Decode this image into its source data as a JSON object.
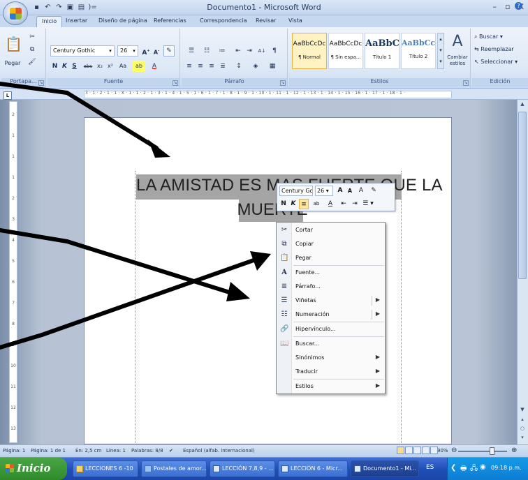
{
  "window": {
    "title": "Documento1 - Microsoft Word",
    "controls": [
      "–",
      "▫",
      "X"
    ]
  },
  "quick_access": {
    "icons": [
      "save-icon",
      "undo-icon",
      "redo-icon",
      "print-preview-icon",
      "print-icon",
      "customize-icon"
    ]
  },
  "ribbon": {
    "tabs": [
      "Inicio",
      "Insertar",
      "Diseño de página",
      "Referencias",
      "Correspondencia",
      "Revisar",
      "Vista"
    ],
    "clipboard": {
      "paste_label": "Pegar",
      "group_label": "Portapa..."
    },
    "font": {
      "font_name": "Century Gothic",
      "font_size": "26",
      "group_label": "Fuente"
    },
    "paragraph": {
      "group_label": "Párrafo"
    },
    "styles": {
      "items": [
        {
          "preview": "AaBbCcDc",
          "name": "¶ Normal"
        },
        {
          "preview": "AaBbCcDc",
          "name": "¶ Sin espa..."
        },
        {
          "preview": "AaBbC",
          "name": "Título 1"
        },
        {
          "preview": "AaBbCc",
          "name": "Título 2"
        }
      ],
      "change_styles": "Cambiar estilos",
      "group_label": "Estilos"
    },
    "editing": {
      "find": "Buscar",
      "replace": "Reemplazar",
      "select": "Seleccionar",
      "group_label": "Edición"
    }
  },
  "ruler": {
    "ticks": "3 · 1 · 2 · 1 · 1 · X · 1 · 1 · 2 · 1 · 3 · 1 · 4 · 1 · 5 · 1 · 6 · 1 · 7 · 1 · 8 · 1 · 9 · 1 · 10 · 1 · 11 · 1 · 12 · 1 · 13 · 1 · 14 · 1 · 15 · 16 · 1 · 17 · 1 · 18 · 1 ·",
    "vertical_ticks": [
      "2",
      "1",
      "1",
      "1",
      "2",
      "3",
      "4",
      "5",
      "6",
      "7",
      "8",
      "9",
      "10",
      "11",
      "12",
      "13"
    ]
  },
  "document": {
    "line1": "LA AMISTAD ES MAS FUERTE QUE LA",
    "line2": "MUERTE"
  },
  "mini_toolbar": {
    "font": "Century Go",
    "size": "26",
    "bold": "N",
    "italic": "K"
  },
  "context_menu": {
    "items": [
      {
        "label": "Cortar",
        "icon": "scissors-icon",
        "submenu": false
      },
      {
        "label": "Copiar",
        "icon": "copy-icon",
        "submenu": false
      },
      {
        "label": "Pegar",
        "icon": "paste-icon",
        "submenu": false
      },
      {
        "label": "Fuente...",
        "icon": "font-icon",
        "submenu": false
      },
      {
        "label": "Párrafo...",
        "icon": "paragraph-icon",
        "submenu": false
      },
      {
        "label": "Viñetas",
        "icon": "bullets-icon",
        "submenu": true
      },
      {
        "label": "Numeración",
        "icon": "numbering-icon",
        "submenu": true
      },
      {
        "label": "Hipervínculo...",
        "icon": "hyperlink-icon",
        "submenu": false
      },
      {
        "label": "Buscar...",
        "icon": "research-icon",
        "submenu": false
      },
      {
        "label": "Sinónimos",
        "icon": "",
        "submenu": true
      },
      {
        "label": "Traducir",
        "icon": "",
        "submenu": true
      },
      {
        "label": "Estilos",
        "icon": "",
        "submenu": true
      }
    ]
  },
  "status": {
    "page": "Página: 1",
    "page_of": "Página: 1 de 1",
    "position": "En: 2,5 cm",
    "line": "Línea: 1",
    "words": "Palabras: 8/8",
    "language": "Español (alfab. internacional)",
    "zoom": "90%"
  },
  "taskbar": {
    "start": "Inicio",
    "tasks": [
      {
        "label": "LECCIONES 6 -10",
        "active": false
      },
      {
        "label": "Postales de amor...",
        "active": false
      },
      {
        "label": "LECCIÓN 7,8,9 - ...",
        "active": false
      },
      {
        "label": "LECCIÓN 6 - Micr...",
        "active": false
      },
      {
        "label": "Documento1 - Mi...",
        "active": true
      }
    ],
    "lang": "ES",
    "clock": "09:18 p.m."
  }
}
